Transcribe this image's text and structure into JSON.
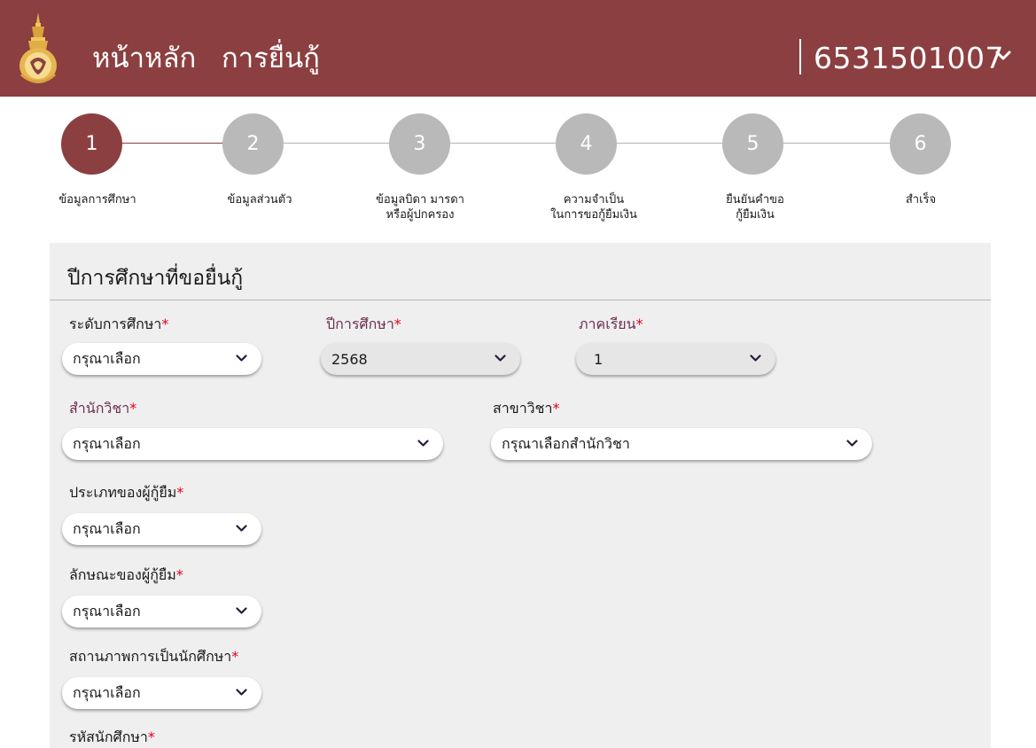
{
  "header": {
    "nav": {
      "home": "หน้าหลัก",
      "apply": "การยื่นกู้"
    },
    "user_id": "6531501007",
    "background_color": "#8c3f40"
  },
  "stepper": {
    "active_step": 1,
    "steps": [
      {
        "number": "1",
        "label_line1": "ข้อมูลการศึกษา",
        "label_line2": ""
      },
      {
        "number": "2",
        "label_line1": "ข้อมูลส่วนตัว",
        "label_line2": ""
      },
      {
        "number": "3",
        "label_line1": "ข้อมูลบิดา มารดา",
        "label_line2": "หรือผู้ปกครอง"
      },
      {
        "number": "4",
        "label_line1": "ความจำเป็น",
        "label_line2": "ในการขอกู้ยืมเงิน"
      },
      {
        "number": "5",
        "label_line1": "ยืนยันคำขอ",
        "label_line2": "กู้ยืมเงิน"
      },
      {
        "number": "6",
        "label_line1": "สำเร็จ",
        "label_line2": ""
      }
    ]
  },
  "form": {
    "title": "ปีการศึกษาที่ขอยื่นกู้",
    "required_mark": "*",
    "fields": {
      "education_level": {
        "label": "ระดับการศึกษา",
        "value": "กรุณาเลือก"
      },
      "academic_year": {
        "label": "ปีการศึกษา",
        "value": "2568"
      },
      "semester": {
        "label": "ภาคเรียน",
        "value": "1"
      },
      "school": {
        "label": "สำนักวิชา",
        "value": "กรุณาเลือก"
      },
      "major": {
        "label": "สาขาวิชา",
        "value": "กรุณาเลือกสำนักวิชา"
      },
      "borrower_type": {
        "label": "ประเภทของผู้กู้ยืม",
        "value": "กรุณาเลือก"
      },
      "borrower_character": {
        "label": "ลักษณะของผู้กู้ยืม",
        "value": "กรุณาเลือก"
      },
      "student_status": {
        "label": "สถานภาพการเป็นนักศึกษา",
        "value": "กรุณาเลือก"
      },
      "student_id": {
        "label": "รหัสนักศึกษา",
        "value": ""
      }
    }
  },
  "colors": {
    "primary": "#8c3f40",
    "step_inactive": "#b9b9b9",
    "required": "#e0001b",
    "panel_bg": "#efefef"
  }
}
